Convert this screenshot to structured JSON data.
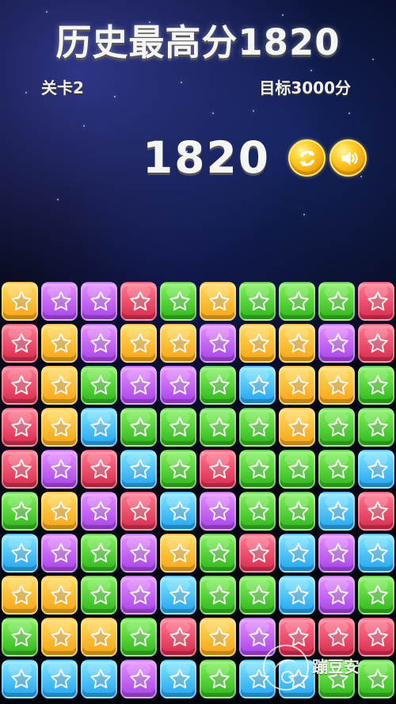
{
  "header": {
    "best_score_title": "历史最高分1820",
    "level": "关卡2",
    "target": "目标3000分",
    "current_score": "1820"
  },
  "controls": {
    "refresh_icon": "refresh-icon",
    "sound_icon": "sound-icon",
    "button_color": "#ffd234"
  },
  "board": {
    "rows": 10,
    "columns": 10,
    "tile_icon": "star-icon",
    "colors": {
      "yellow": "#ffd95e",
      "purple": "#d17df8",
      "red": "#f0506d",
      "green": "#55d63d",
      "blue": "#57c9ff"
    },
    "cells": [
      [
        "yellow",
        "purple",
        "purple",
        "red",
        "green",
        "yellow",
        "green",
        "green",
        "green",
        "red"
      ],
      [
        "red",
        "yellow",
        "purple",
        "yellow",
        "yellow",
        "purple",
        "yellow",
        "yellow",
        "purple",
        "red"
      ],
      [
        "red",
        "yellow",
        "green",
        "purple",
        "purple",
        "green",
        "blue",
        "yellow",
        "yellow",
        "green"
      ],
      [
        "red",
        "yellow",
        "blue",
        "green",
        "green",
        "green",
        "green",
        "yellow",
        "green",
        "green"
      ],
      [
        "red",
        "purple",
        "red",
        "blue",
        "green",
        "red",
        "green",
        "green",
        "green",
        "blue"
      ],
      [
        "green",
        "yellow",
        "purple",
        "red",
        "blue",
        "purple",
        "green",
        "green",
        "blue",
        "red"
      ],
      [
        "blue",
        "purple",
        "green",
        "purple",
        "yellow",
        "green",
        "red",
        "blue",
        "purple",
        "blue"
      ],
      [
        "yellow",
        "yellow",
        "green",
        "purple",
        "blue",
        "green",
        "green",
        "blue",
        "purple",
        "green"
      ],
      [
        "green",
        "yellow",
        "yellow",
        "green",
        "red",
        "yellow",
        "purple",
        "red",
        "red",
        "red"
      ],
      [
        "blue",
        "blue",
        "blue",
        "purple",
        "blue",
        "green",
        "blue",
        "blue",
        "green",
        "green"
      ]
    ]
  },
  "watermark": {
    "logo_icon": "logo-icon",
    "text": "蹦豆安"
  }
}
